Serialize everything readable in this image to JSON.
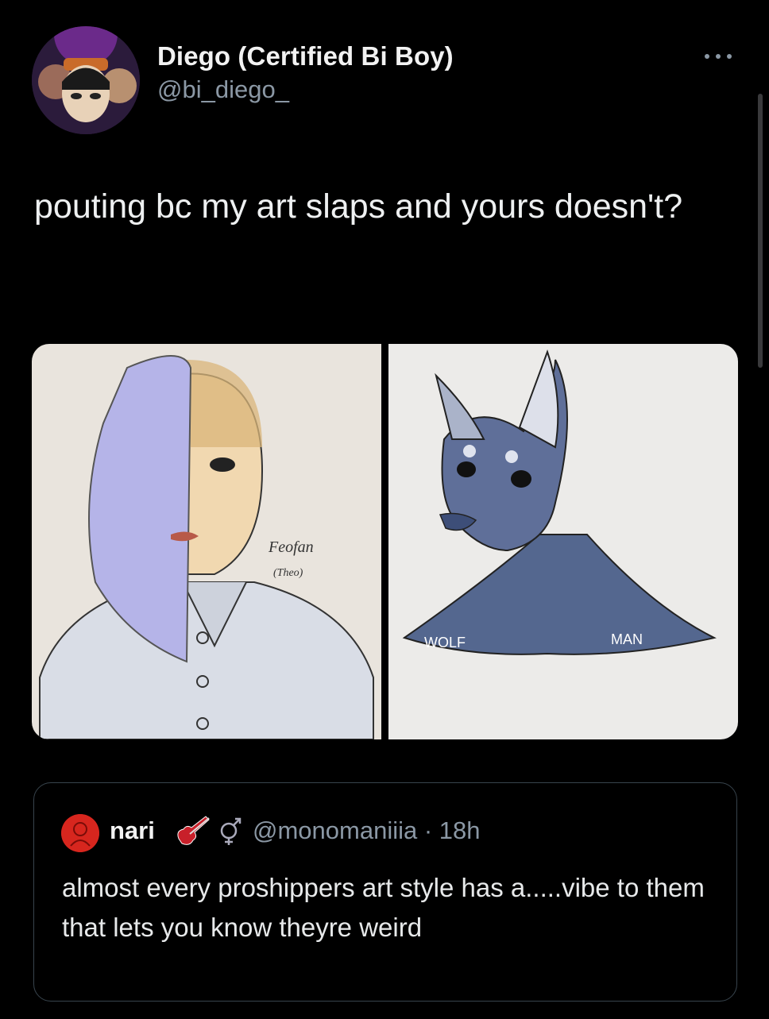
{
  "tweet": {
    "author_name": "Diego (Certified Bi Boy)",
    "author_handle": "@bi_diego_",
    "more_icon": "more-horizontal-icon",
    "text": "pouting bc my art slaps and yours doesn't?",
    "images": [
      {
        "label_1": "Feofan",
        "label_2": "(Theo)"
      },
      {
        "label_1": "WOLF",
        "label_2": "MAN"
      }
    ]
  },
  "quote": {
    "author_name": "nari",
    "emoji_1": "guitar-icon",
    "emoji_2": "gender-symbol-icon",
    "handle_time": "@monomaniiia · 18h",
    "text": "almost every proshippers art style has a.....vibe to them that lets you know theyre weird"
  },
  "colors": {
    "background": "#000000",
    "text": "#e7e9ea",
    "secondary": "#8b98a5",
    "border": "#38444d",
    "quote_avatar": "#d7261e"
  }
}
